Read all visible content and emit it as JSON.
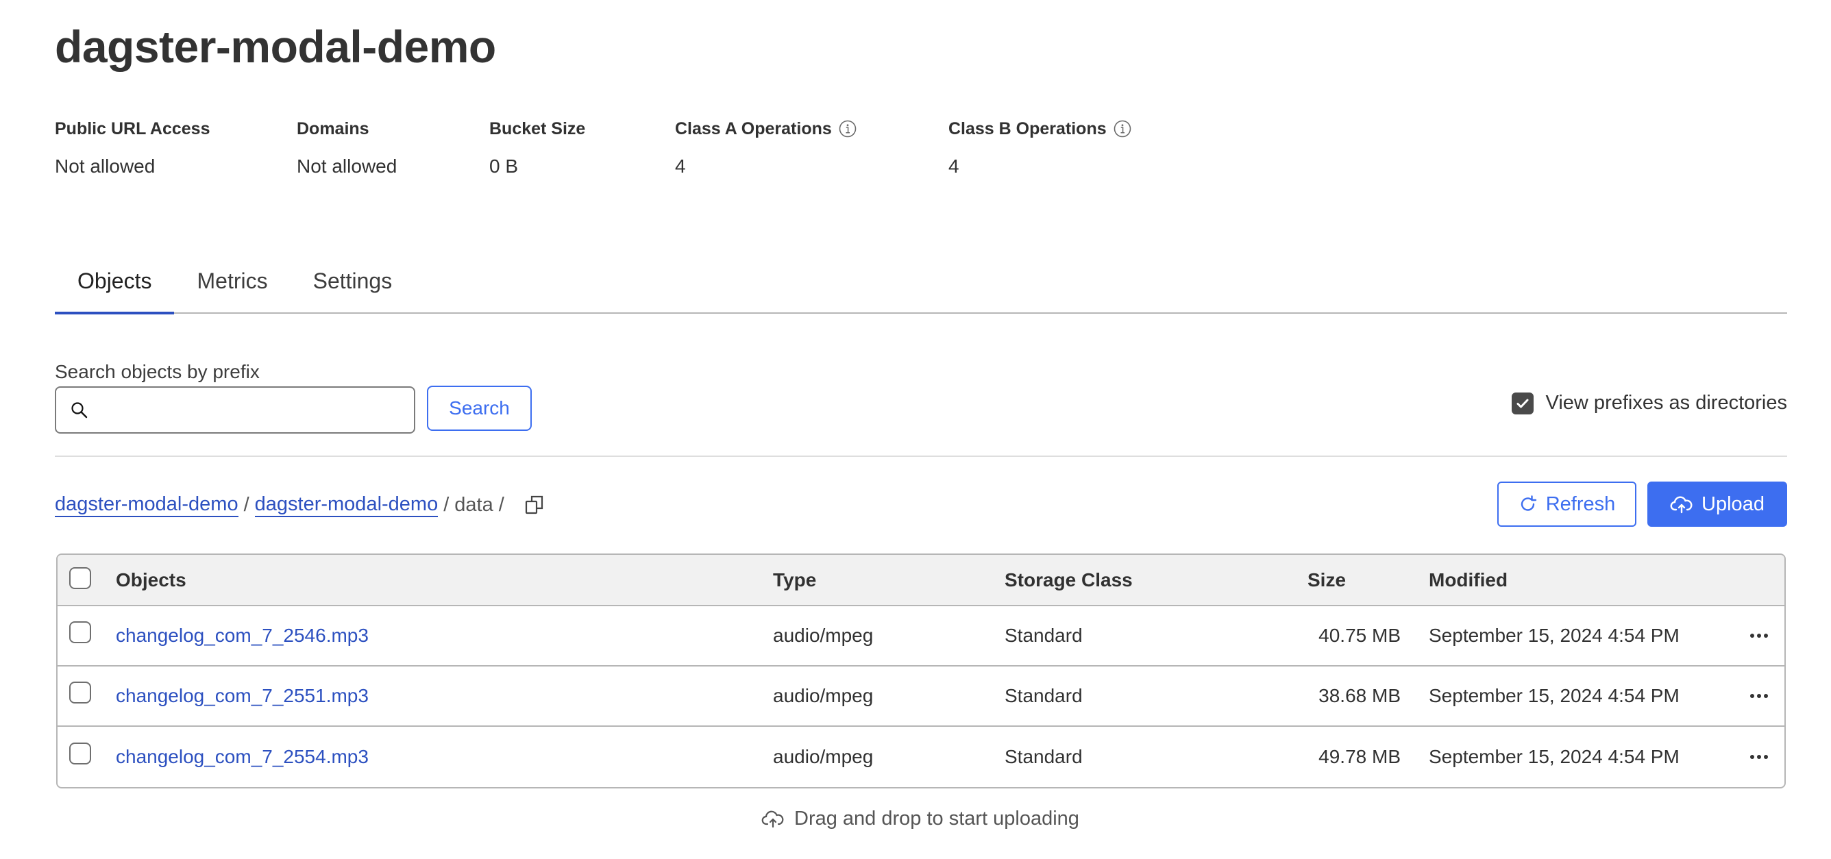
{
  "page": {
    "title": "dagster-modal-demo"
  },
  "stats": [
    {
      "label": "Public URL Access",
      "value": "Not allowed",
      "info": false
    },
    {
      "label": "Domains",
      "value": "Not allowed",
      "info": false
    },
    {
      "label": "Bucket Size",
      "value": "0 B",
      "info": false
    },
    {
      "label": "Class A Operations",
      "value": "4",
      "info": true
    },
    {
      "label": "Class B Operations",
      "value": "4",
      "info": true
    }
  ],
  "tabs": [
    {
      "label": "Objects",
      "active": true
    },
    {
      "label": "Metrics",
      "active": false
    },
    {
      "label": "Settings",
      "active": false
    }
  ],
  "search": {
    "label": "Search objects by prefix",
    "value": "",
    "placeholder": "",
    "button_label": "Search"
  },
  "prefix_toggle": {
    "label": "View prefixes as directories",
    "checked": true
  },
  "breadcrumb": {
    "links": [
      "dagster-modal-demo",
      "dagster-modal-demo"
    ],
    "current": "data",
    "separator": "/"
  },
  "actions": {
    "refresh_label": "Refresh",
    "upload_label": "Upload"
  },
  "table": {
    "columns": [
      "Objects",
      "Type",
      "Storage Class",
      "Size",
      "Modified"
    ],
    "rows": [
      {
        "name": "changelog_com_7_2546.mp3",
        "type": "audio/mpeg",
        "storage_class": "Standard",
        "size": "40.75 MB",
        "modified": "September 15, 2024 4:54 PM"
      },
      {
        "name": "changelog_com_7_2551.mp3",
        "type": "audio/mpeg",
        "storage_class": "Standard",
        "size": "38.68 MB",
        "modified": "September 15, 2024 4:54 PM"
      },
      {
        "name": "changelog_com_7_2554.mp3",
        "type": "audio/mpeg",
        "storage_class": "Standard",
        "size": "49.78 MB",
        "modified": "September 15, 2024 4:54 PM"
      }
    ]
  },
  "dropzone": {
    "label": "Drag and drop to start uploading"
  },
  "colors": {
    "accent": "#3d6ef0",
    "link": "#2c50c0",
    "tab_active": "#2c50c0",
    "header_bg": "#f1f1f1",
    "border": "#b6b6b6"
  }
}
